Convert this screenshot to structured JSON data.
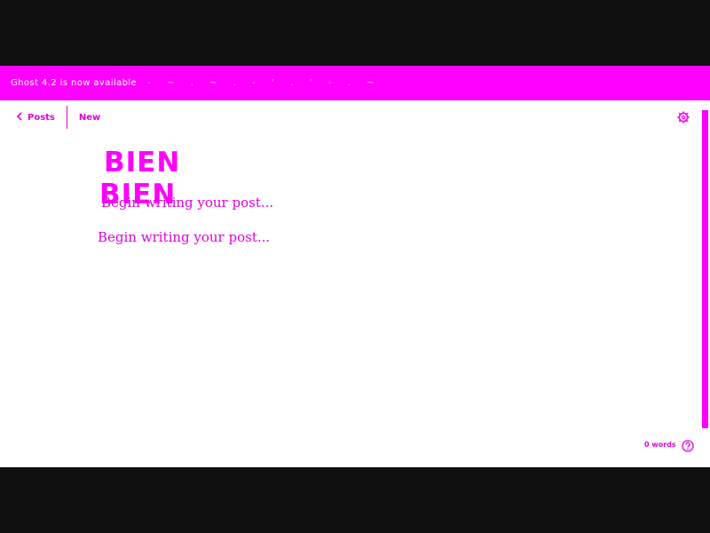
{
  "banner": {
    "text": "Ghost 4.2 is now available",
    "trailing": "-     ~     .     ~     .     -     '     .     '     -     .     ~"
  },
  "nav": {
    "back_label": "Posts",
    "status_label": "New"
  },
  "editor": {
    "title_text": "BIEN",
    "title_ghost_text": "BIEN",
    "body_placeholder": "Begin writing your post...",
    "body_ghost_placeholder": "Begin writing your post..."
  },
  "footer": {
    "word_count": "0 words"
  },
  "icons": {
    "back": "chevron-left-icon",
    "settings": "gear-icon",
    "help": "question-circle-icon"
  },
  "colors": {
    "accent": "#ff00ff",
    "text_accent": "#e000e0",
    "background": "#ffffff",
    "frame": "#0f0f0f"
  }
}
